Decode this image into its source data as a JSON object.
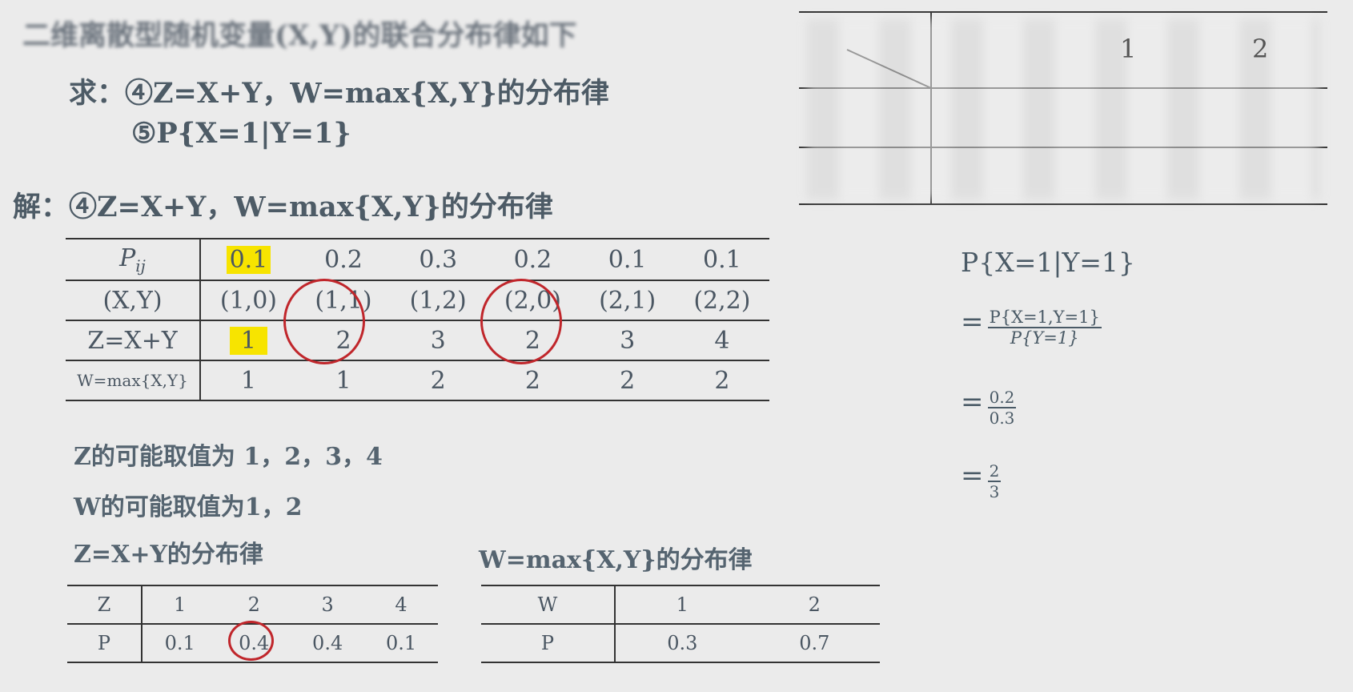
{
  "header": {
    "obscured_title": "二维离散型随机变量(X,Y)的联合分布律如下"
  },
  "question": {
    "line1": "求：④Z=X+Y，W=max{X,Y}的分布律",
    "line2": "⑤P{X=1|Y=1}"
  },
  "solution": {
    "heading": "解：④Z=X+Y，W=max{X,Y}的分布律",
    "main_table": {
      "row_labels": [
        "P_ij",
        "(X,Y)",
        "Z=X+Y",
        "W=max{X,Y}"
      ],
      "p_label_main": "P",
      "p_label_sub": "ij",
      "p_values": [
        "0.1",
        "0.2",
        "0.3",
        "0.2",
        "0.1",
        "0.1"
      ],
      "xy_values": [
        "(1,0)",
        "(1,1)",
        "(1,2)",
        "(2,0)",
        "(2,1)",
        "(2,2)"
      ],
      "z_values": [
        "1",
        "2",
        "3",
        "2",
        "3",
        "4"
      ],
      "w_values": [
        "1",
        "1",
        "2",
        "2",
        "2",
        "2"
      ]
    },
    "z_possible": "Z的可能取值为 1，2，3，4",
    "w_possible": "W的可能取值为1，2",
    "z_dist_title": "Z=X+Y的分布律",
    "w_dist_title": "W=max{X,Y}的分布律",
    "z_table": {
      "head": "Z",
      "values": [
        "1",
        "2",
        "3",
        "4"
      ],
      "p_head": "P",
      "p_values": [
        "0.1",
        "0.4",
        "0.4",
        "0.1"
      ]
    },
    "w_table": {
      "head": "W",
      "values": [
        "1",
        "2"
      ],
      "p_head": "P",
      "p_values": [
        "0.3",
        "0.7"
      ]
    }
  },
  "conditional": {
    "title": "P{X=1|Y=1}",
    "eq": "=",
    "step1_num": "P{X=1,Y=1}",
    "step1_den": "P{Y=1}",
    "step2_num": "0.2",
    "step2_den": "0.3",
    "step3_num": "2",
    "step3_den": "3"
  },
  "top_right_table": {
    "col_headers": [
      "1",
      "2"
    ]
  },
  "colors": {
    "highlight": "#f7e400",
    "circle": "#c0262b",
    "text": "#4a5a66"
  }
}
